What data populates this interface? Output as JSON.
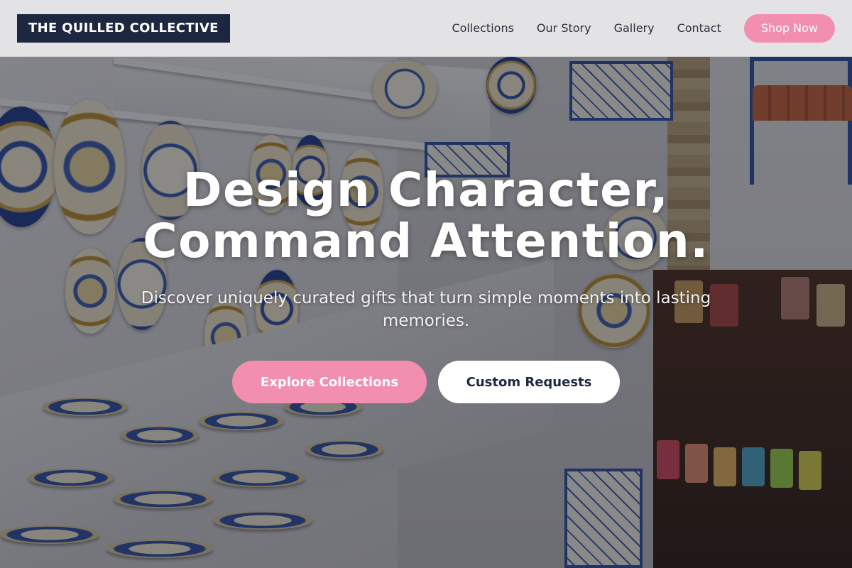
{
  "brand": {
    "name": "THE QUILLED COLLECTIVE",
    "colors": {
      "navy": "#1d2740",
      "pink": "#f28fb0"
    }
  },
  "nav": {
    "links": [
      "Collections",
      "Our Story",
      "Gallery",
      "Contact"
    ],
    "cta_label": "Shop Now"
  },
  "hero": {
    "headline_line1": "Design Character,",
    "headline_line2": "Command Attention.",
    "subtitle": "Discover uniquely curated gifts that turn simple moments into lasting memories.",
    "primary_cta": "Explore Collections",
    "secondary_cta": "Custom Requests"
  }
}
